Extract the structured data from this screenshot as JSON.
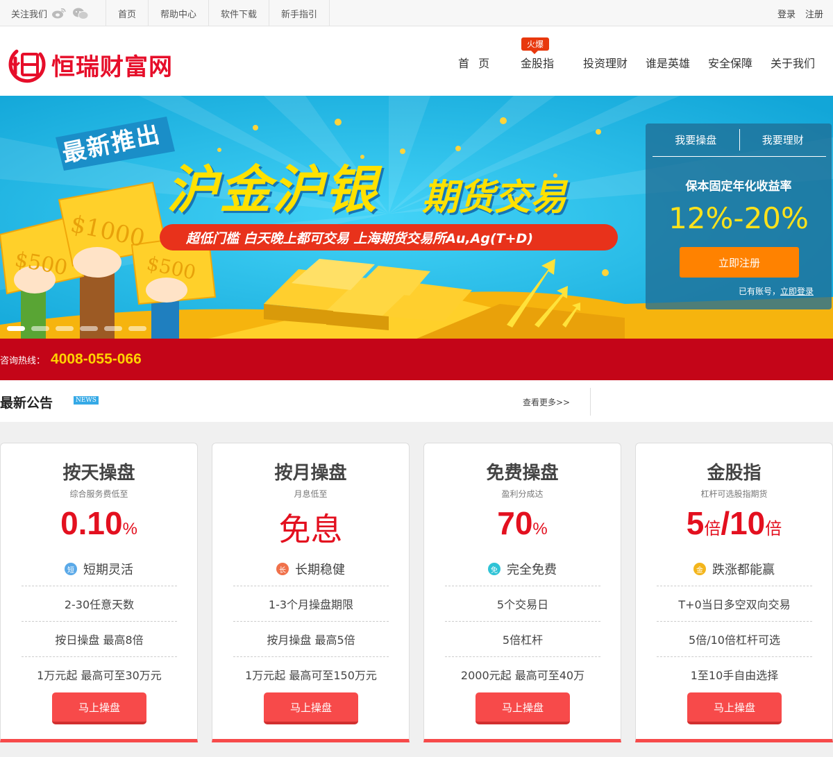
{
  "topbar": {
    "follow_label": "关注我们",
    "social_icons": [
      "weibo-icon",
      "wechat-icon"
    ],
    "links": [
      "首页",
      "帮助中心",
      "软件下载",
      "新手指引"
    ],
    "login": "登录",
    "register": "注册"
  },
  "header": {
    "logo_text": "恒瑞财富网",
    "nav": [
      "首  页",
      "金股指",
      "投资理财",
      "谁是英雄",
      "安全保障",
      "关于我们"
    ],
    "hot_badge": "火爆"
  },
  "banner": {
    "tag": "最新推出",
    "title_main": "沪金沪银",
    "title_sub": "期货交易",
    "subline": "超低门槛   白天晚上都可交易   上海期货交易所Au,Ag(T+D)",
    "money_labels": [
      "$500",
      "$1000",
      "$500"
    ],
    "slide_count": 6,
    "active_slide": 1
  },
  "register_panel": {
    "tabs": [
      "我要操盘",
      "我要理财"
    ],
    "rate_label": "保本固定年化收益率",
    "rate_value": "12%-20%",
    "register_button": "立即注册",
    "has_account": "已有账号，",
    "login_link": "立即登录"
  },
  "hotline": {
    "label": "咨询热线：",
    "number": "4008-055-066"
  },
  "news": {
    "title": "最新公告",
    "badge": "NEWS",
    "more": "查看更多>>"
  },
  "colors": {
    "brand_red": "#e60e2a",
    "hotline_bg": "#c40518",
    "accent_orange": "#ff8200",
    "button_red": "#f74a4a",
    "banner_blue": "#21b9e4",
    "rate_yellow": "#ffe21a"
  },
  "cards": [
    {
      "title": "按天操盘",
      "subtitle": "综合服务费低至",
      "value_main": "0.10",
      "value_unit": "%",
      "feature_icon": "短",
      "feature_icon_color": "#5aa9e8",
      "feature": "短期灵活",
      "rows": [
        "2-30任意天数",
        "按日操盘 最高8倍",
        "1万元起 最高可至30万元"
      ],
      "button": "马上操盘"
    },
    {
      "title": "按月操盘",
      "subtitle": "月息低至",
      "value_main": "免息",
      "value_unit": "",
      "feature_icon": "长",
      "feature_icon_color": "#f0714b",
      "feature": "长期稳健",
      "rows": [
        "1-3个月操盘期限",
        "按月操盘 最高5倍",
        "1万元起 最高可至150万元"
      ],
      "button": "马上操盘"
    },
    {
      "title": "免费操盘",
      "subtitle": "盈利分成达",
      "value_main": "70",
      "value_unit": "%",
      "feature_icon": "免",
      "feature_icon_color": "#2fc3d6",
      "feature": "完全免费",
      "rows": [
        "5个交易日",
        "5倍杠杆",
        "2000元起 最高可至40万"
      ],
      "button": "马上操盘"
    },
    {
      "title": "金股指",
      "subtitle": "杠杆可选股指期货",
      "value_a": "5",
      "unit_a": "倍",
      "value_sep": "/",
      "value_b": "10",
      "unit_b": "倍",
      "feature_icon": "金",
      "feature_icon_color": "#f3b51b",
      "feature": "跌涨都能赢",
      "rows": [
        "T+0当日多空双向交易",
        "5倍/10倍杠杆可选",
        "1至10手自由选择"
      ],
      "button": "马上操盘"
    }
  ]
}
